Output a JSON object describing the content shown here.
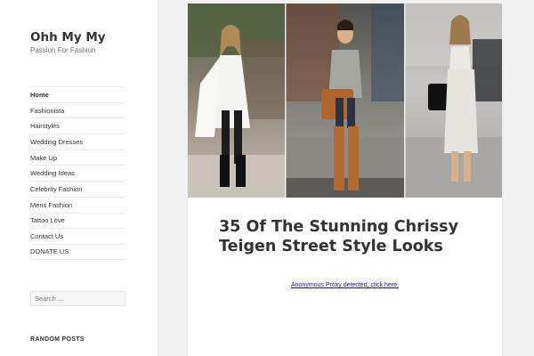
{
  "site": {
    "title": "Ohh My My",
    "description": "Passion For Fashion"
  },
  "nav": {
    "items": [
      {
        "label": "Home",
        "active": true
      },
      {
        "label": "Fashionista"
      },
      {
        "label": "Hairstyles"
      },
      {
        "label": "Wedding Dresses"
      },
      {
        "label": "Make Up"
      },
      {
        "label": "Wedding Ideas"
      },
      {
        "label": "Celebrity Fashion"
      },
      {
        "label": "Mens Fashion"
      },
      {
        "label": "Tattoo Love"
      },
      {
        "label": "Contact Us"
      },
      {
        "label": "DONATE US"
      }
    ]
  },
  "search": {
    "placeholder": "Search …"
  },
  "widgets": {
    "random_posts_title": "RANDOM POSTS"
  },
  "post": {
    "title": "35 Of The Stunning Chrissy Teigen Street Style Looks",
    "proxy_link": "Anonymous Proxy detected, click here."
  },
  "colors": {
    "page_bg": "#f1f1f1",
    "panel_bg": "#ffffff",
    "text": "#333333",
    "link": "#1a0dab"
  }
}
